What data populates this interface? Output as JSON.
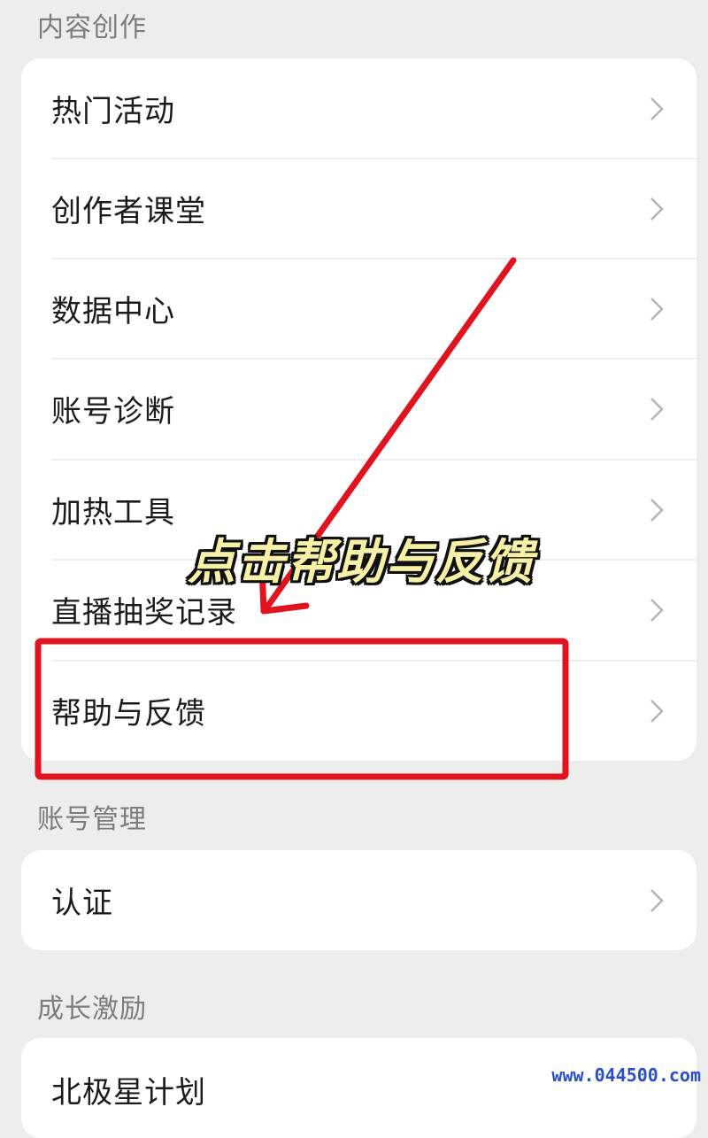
{
  "sections": {
    "content": {
      "title": "内容创作",
      "items": [
        {
          "label": "热门活动"
        },
        {
          "label": "创作者课堂"
        },
        {
          "label": "数据中心"
        },
        {
          "label": "账号诊断"
        },
        {
          "label": "加热工具"
        },
        {
          "label": "直播抽奖记录"
        },
        {
          "label": "帮助与反馈"
        }
      ]
    },
    "account": {
      "title": "账号管理",
      "items": [
        {
          "label": "认证"
        }
      ]
    },
    "growth": {
      "title": "成长激励",
      "items": [
        {
          "label": "北极星计划"
        }
      ]
    }
  },
  "annotation": {
    "caption": "点击帮助与反馈",
    "highlight_color": "#e0141e"
  },
  "watermark": "www.044500.com",
  "icons": {
    "row_chevron": "chevron-right-icon"
  }
}
